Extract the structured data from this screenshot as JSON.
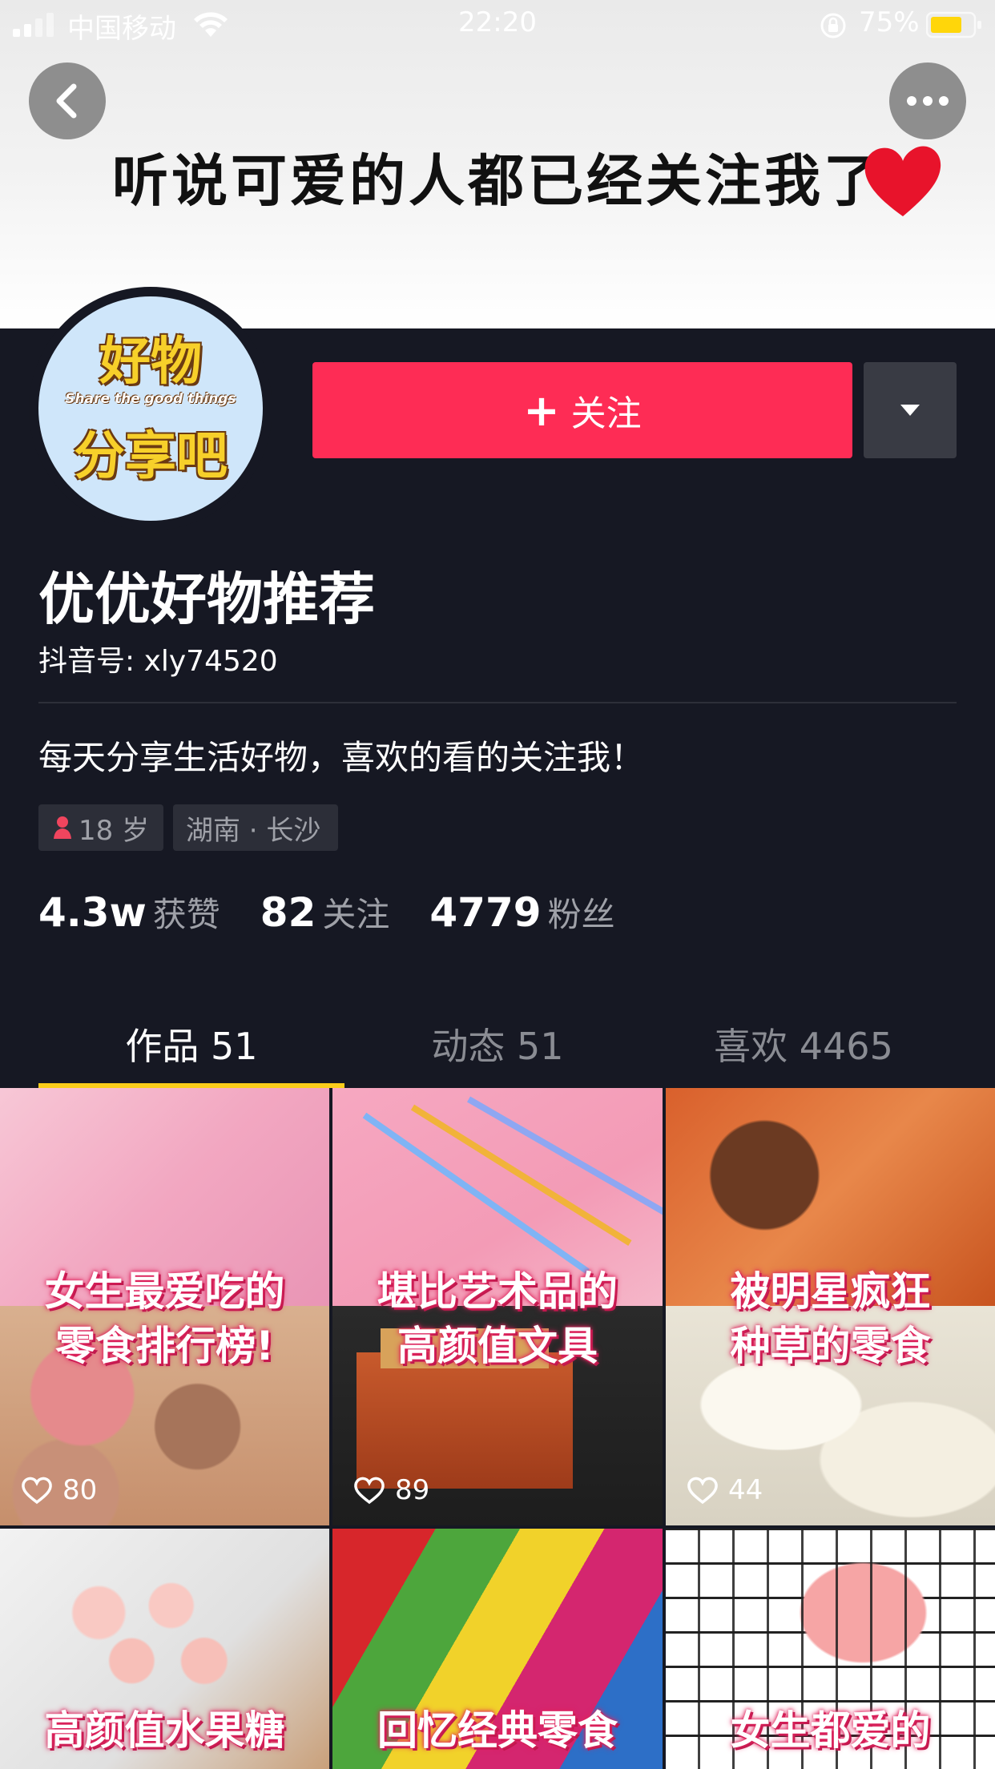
{
  "status_bar": {
    "carrier": "中国移动",
    "time": "22:20",
    "battery_percent": "75%",
    "icons": [
      "signal-icon",
      "wifi-icon",
      "rotation-lock-icon",
      "battery-icon"
    ]
  },
  "banner": {
    "text": "听说可爱的人都已经关注我了",
    "icons": [
      "red-heart-icon"
    ]
  },
  "header_buttons": {
    "back_icon": "chevron-left-icon",
    "more_icon": "more-dots-icon"
  },
  "avatar": {
    "line1": "好物",
    "line2": "Share the good things",
    "line3": "分享吧"
  },
  "follow_button": {
    "plus": "+",
    "label": "关注"
  },
  "dropdown_icon": "triangle-down-icon",
  "profile": {
    "name": "优优好物推荐",
    "douyin_id": "抖音号: xly74520",
    "bio": "每天分享生活好物，喜欢的看的关注我！",
    "tags": [
      {
        "label": "18 岁",
        "icon": "female-icon"
      },
      {
        "label": "湖南 · 长沙"
      }
    ]
  },
  "stats": [
    {
      "value": "4.3w",
      "label": "获赞"
    },
    {
      "value": "82",
      "label": "关注"
    },
    {
      "value": "4779",
      "label": "粉丝"
    }
  ],
  "tabs": [
    {
      "label": "作品 51",
      "active": true
    },
    {
      "label": "动态 51",
      "active": false
    },
    {
      "label": "喜欢 4465",
      "active": false
    }
  ],
  "videos": [
    {
      "caption_line1": "女生最爱吃的",
      "caption_line2": "零食排行榜!",
      "likes": "80"
    },
    {
      "caption_line1": "堪比艺术品的",
      "caption_line2": "高颜值文具",
      "likes": "89"
    },
    {
      "caption_line1": "被明星疯狂",
      "caption_line2": "种草的零食",
      "likes": "44"
    },
    {
      "caption_line1": "高颜值水果糖",
      "caption_line2": ""
    },
    {
      "caption_line1": "回忆经典零食",
      "caption_line2": ""
    },
    {
      "caption_line1": "女生都爱的",
      "caption_line2": ""
    }
  ],
  "colors": {
    "background": "#161823",
    "follow_button": "#fe2c55",
    "tab_indicator": "#facd1a",
    "secondary_text": "#9fa1a8"
  }
}
